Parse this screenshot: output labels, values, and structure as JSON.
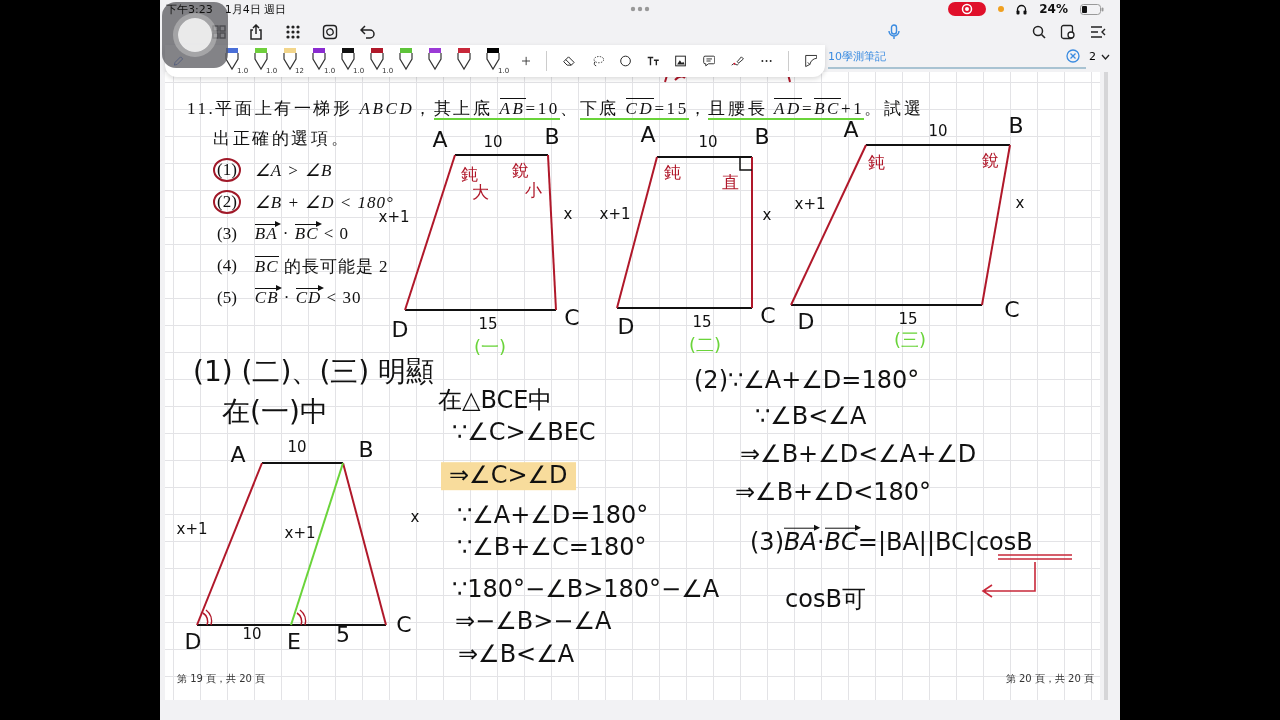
{
  "status_bar": {
    "time": "下午3:23",
    "date": "1月4日 週日",
    "battery": "24%",
    "recording": true
  },
  "toolbar": {
    "pens": [
      {
        "color": "#4a6fd8",
        "size": "1.0"
      },
      {
        "color": "#6fcf3c",
        "size": "1.0"
      },
      {
        "color": "#f2d58a",
        "size": "12"
      },
      {
        "color": "#8a2bd0",
        "size": "1.0"
      },
      {
        "color": "#111111",
        "size": "1.0"
      },
      {
        "color": "#b0182a",
        "size": "1.0"
      },
      {
        "color": "#5ec43a"
      },
      {
        "color": "#9b3ad6"
      },
      {
        "color": "#c8283a"
      },
      {
        "color": "#000000",
        "size": "1.0"
      }
    ],
    "document_title": "10學測筆記",
    "page_number": "2"
  },
  "question": {
    "line1": [
      {
        "text": "11.平面上有一梯形 ",
        "kind": "text",
        "underlined": false
      },
      {
        "text": "ABCD",
        "kind": "math",
        "underlined": false
      },
      {
        "text": "，",
        "kind": "text",
        "underlined": false
      },
      {
        "text": "其上底 ",
        "kind": "text",
        "underlined": true
      },
      {
        "text": "AB",
        "kind": "overline",
        "underlined": true
      },
      {
        "text": "=10",
        "kind": "text",
        "underlined": true
      },
      {
        "text": "、",
        "kind": "text",
        "underlined": false
      },
      {
        "text": "下底 ",
        "kind": "text",
        "underlined": true
      },
      {
        "text": "CD",
        "kind": "overline",
        "underlined": true
      },
      {
        "text": "=15",
        "kind": "text",
        "underlined": true
      },
      {
        "text": "，",
        "kind": "text",
        "underlined": false
      },
      {
        "text": "且腰長 ",
        "kind": "text",
        "underlined": true
      },
      {
        "text": "AD",
        "kind": "overline",
        "underlined": true
      },
      {
        "text": "=",
        "kind": "text",
        "underlined": true
      },
      {
        "text": "BC",
        "kind": "overline",
        "underlined": true
      },
      {
        "text": "+1",
        "kind": "text",
        "underlined": true
      },
      {
        "text": "。試選",
        "kind": "text",
        "underlined": false
      }
    ],
    "line2": "出正確的選項。",
    "options": [
      {
        "number": "(1)",
        "circled": true,
        "parts": [
          {
            "text": "∠A > ∠B",
            "kind": "math"
          }
        ]
      },
      {
        "number": "(2)",
        "circled": true,
        "parts": [
          {
            "text": "∠B + ∠D < 180°",
            "kind": "math"
          }
        ]
      },
      {
        "number": "(3)",
        "circled": false,
        "parts": [
          {
            "text": "BA",
            "kind": "vector"
          },
          {
            "text": " · ",
            "kind": "text"
          },
          {
            "text": "BC",
            "kind": "vector"
          },
          {
            "text": " < 0",
            "kind": "text"
          }
        ]
      },
      {
        "number": "(4)",
        "circled": false,
        "parts": [
          {
            "text": "BC",
            "kind": "overline"
          },
          {
            "text": " 的長可能是 2",
            "kind": "text"
          }
        ]
      },
      {
        "number": "(5)",
        "circled": false,
        "parts": [
          {
            "text": "CB",
            "kind": "vector"
          },
          {
            "text": " · ",
            "kind": "text"
          },
          {
            "text": "CD",
            "kind": "vector"
          },
          {
            "text": " < 30",
            "kind": "text"
          }
        ]
      }
    ]
  },
  "diagrams": [
    {
      "kind": "trapezoid",
      "labels": [
        "A",
        "10",
        "B",
        "x+1",
        "x",
        "D",
        "15",
        "C"
      ],
      "angle_notes": [
        "鈍",
        "大",
        "銳",
        "小"
      ],
      "caption": "(一)"
    },
    {
      "kind": "right",
      "labels": [
        "A",
        "10",
        "B",
        "x+1",
        "x",
        "D",
        "15",
        "C"
      ],
      "angle_notes": [
        "鈍",
        "直"
      ],
      "caption": "(二)"
    },
    {
      "kind": "slanted",
      "labels": [
        "A",
        "10",
        "B",
        "x+1",
        "x",
        "D",
        "15",
        "C"
      ],
      "angle_notes": [
        "鈍",
        "銳"
      ],
      "caption": "(三)"
    },
    {
      "kind": "split",
      "labels": [
        "A",
        "10",
        "B",
        "x+1",
        "x+1",
        "x",
        "D",
        "10",
        "E",
        "5",
        "C"
      ]
    }
  ],
  "notes": [
    {
      "kind": "plain",
      "text": "(1) (二)、(三) 明顯",
      "highlighted": false
    },
    {
      "kind": "plain",
      "text": "在(一)中",
      "highlighted": false
    },
    {
      "kind": "plain",
      "text": "在△BCE中",
      "highlighted": false
    },
    {
      "kind": "plain",
      "text": "∵∠C>∠BEC",
      "highlighted": false
    },
    {
      "kind": "plain",
      "text": "⇒∠C>∠D",
      "highlighted": true
    },
    {
      "kind": "plain",
      "text": "∵∠A+∠D=180°",
      "highlighted": false
    },
    {
      "kind": "plain",
      "text": "∵∠B+∠C=180°",
      "highlighted": false
    },
    {
      "kind": "plain",
      "text": "∵180°−∠B>180°−∠A",
      "highlighted": false
    },
    {
      "kind": "plain",
      "text": "⇒−∠B>−∠A",
      "highlighted": false
    },
    {
      "kind": "plain",
      "text": "⇒∠B<∠A",
      "highlighted": false
    },
    {
      "kind": "plain",
      "text": "(2)∵∠A+∠D=180°",
      "highlighted": false
    },
    {
      "kind": "plain",
      "text": "∵∠B<∠A",
      "highlighted": false
    },
    {
      "kind": "plain",
      "text": "⇒∠B+∠D<∠A+∠D",
      "highlighted": false
    },
    {
      "kind": "plain",
      "text": "⇒∠B+∠D<180°",
      "highlighted": false
    },
    {
      "kind": "formula",
      "parts": [
        {
          "text": "(3)",
          "kind": "text"
        },
        {
          "text": "BA",
          "kind": "vector"
        },
        {
          "text": "·",
          "kind": "text"
        },
        {
          "text": "BC",
          "kind": "vector"
        },
        {
          "text": "=|BA||BC|cosB",
          "kind": "text"
        }
      ],
      "highlighted": false
    },
    {
      "kind": "plain",
      "text": "cosB可",
      "highlighted": false
    }
  ],
  "footers": [
    "第 19 頁，共 20 頁",
    "第 20 頁，共 20 頁"
  ]
}
